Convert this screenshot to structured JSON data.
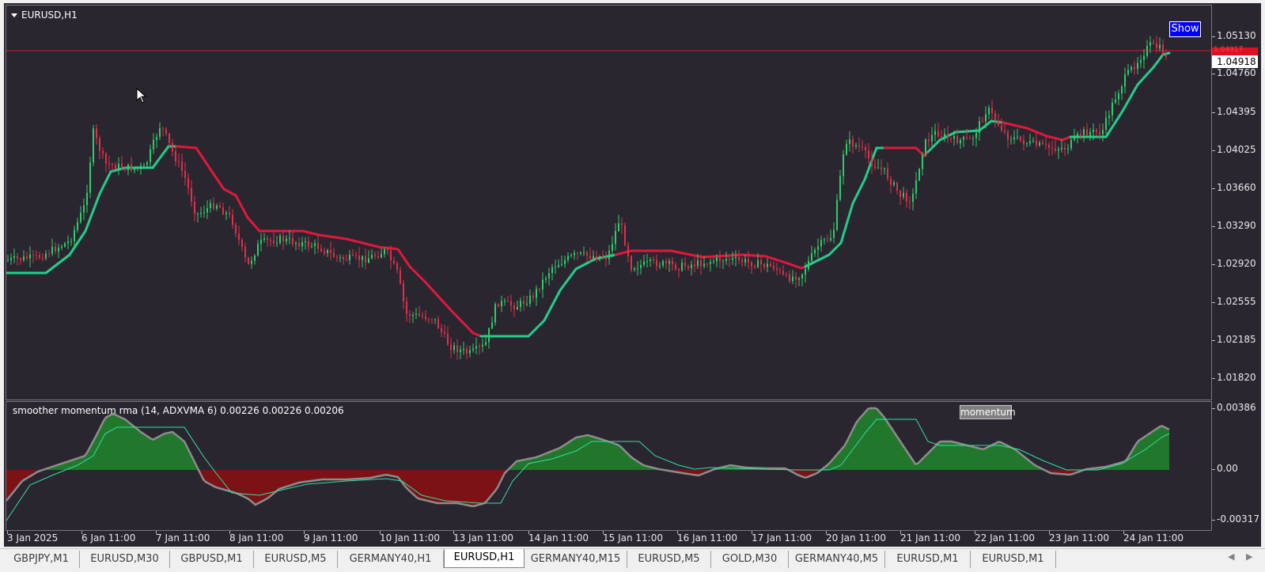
{
  "chart": {
    "symbol_title": "EURUSD,H1",
    "show_button": "Show",
    "indicator_title": "smoother momentum rma (14, ADXVMA 6) 0.00226 0.00226 0.00206",
    "momentum_button": "momentum",
    "bid_badge": "1.04917",
    "current_price": "1.04918",
    "price_axis": [
      "1.05130",
      "1.04760",
      "1.04395",
      "1.04025",
      "1.03660",
      "1.03290",
      "1.02920",
      "1.02555",
      "1.02185",
      "1.01820"
    ],
    "sub_axis": [
      "0.00386",
      "0.00",
      "-0.00317"
    ],
    "time_axis": [
      "3 Jan 2025",
      "6 Jan 11:00",
      "7 Jan 11:00",
      "8 Jan 11:00",
      "9 Jan 11:00",
      "10 Jan 11:00",
      "13 Jan 11:00",
      "14 Jan 11:00",
      "15 Jan 11:00",
      "16 Jan 11:00",
      "17 Jan 11:00",
      "20 Jan 11:00",
      "21 Jan 11:00",
      "22 Jan 11:00",
      "23 Jan 11:00",
      "24 Jan 11:00"
    ],
    "colors": {
      "background": "#2a2630",
      "bull": "#1fd08a",
      "bear": "#e0183c",
      "hist_pos": "#1e9a2a",
      "hist_neg": "#a00a0a",
      "momentum_line": "#8c8c8c",
      "signal_line": "#30e0a0"
    }
  },
  "tabs": [
    {
      "label": "GBPJPY,M1",
      "active": false
    },
    {
      "label": "EURUSD,M30",
      "active": false
    },
    {
      "label": "GBPUSD,M1",
      "active": false
    },
    {
      "label": "EURUSD,M5",
      "active": false
    },
    {
      "label": "GERMANY40,H1",
      "active": false
    },
    {
      "label": "EURUSD,H1",
      "active": true
    },
    {
      "label": "GERMANY40,M15",
      "active": false
    },
    {
      "label": "EURUSD,M5",
      "active": false
    },
    {
      "label": "GOLD,M30",
      "active": false
    },
    {
      "label": "GERMANY40,M5",
      "active": false
    },
    {
      "label": "EURUSD,M1",
      "active": false
    },
    {
      "label": "EURUSD,M1",
      "active": false
    }
  ],
  "icons": {
    "symbol_dropdown": "triangle-down-icon",
    "scroll_left": "triangle-left-icon",
    "scroll_right": "triangle-right-icon",
    "cursor": "mouse-pointer-icon"
  }
}
